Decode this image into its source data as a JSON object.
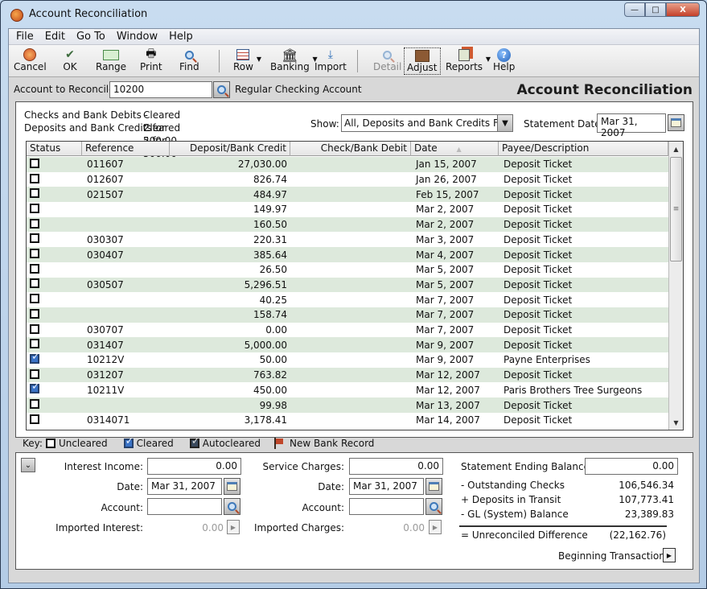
{
  "window": {
    "title": "Account Reconciliation",
    "controls": {
      "minimize": "—",
      "maximize": "□",
      "close": "X"
    }
  },
  "menubar": [
    "File",
    "Edit",
    "Go To",
    "Window",
    "Help"
  ],
  "toolbar": {
    "cancel": "Cancel",
    "ok": "OK",
    "range": "Range",
    "print": "Print",
    "find": "Find",
    "row": "Row",
    "banking": "Banking",
    "import": "Import",
    "detail": "Detail",
    "adjust": "Adjust",
    "reports": "Reports",
    "help": "Help"
  },
  "account": {
    "label": "Account to Reconcile:",
    "value": "10200",
    "description": "Regular Checking Account",
    "heading": "Account Reconciliation"
  },
  "summary": {
    "checks_label": "Checks and Bank Debits -",
    "checks_value": "Cleared 2 for 500.00",
    "deposits_label": "Deposits and Bank Credits -",
    "deposits_value": "Cleared 2 for 500.00"
  },
  "filters": {
    "show_label": "Show:",
    "show_value": "All, Deposits and Bank Credits First",
    "statement_date_label": "Statement Date:",
    "statement_date": "Mar 31, 2007"
  },
  "grid": {
    "columns": [
      "Status",
      "Reference",
      "Deposit/Bank Credit",
      "Check/Bank Debit",
      "Date",
      "Payee/Description"
    ],
    "sort_indicator": "▲",
    "rows": [
      {
        "status": false,
        "ref": "011607",
        "credit": "27,030.00",
        "debit": "",
        "date": "Jan 15, 2007",
        "payee": "Deposit Ticket"
      },
      {
        "status": false,
        "ref": "012607",
        "credit": "826.74",
        "debit": "",
        "date": "Jan 26, 2007",
        "payee": "Deposit Ticket"
      },
      {
        "status": false,
        "ref": "021507",
        "credit": "484.97",
        "debit": "",
        "date": "Feb 15, 2007",
        "payee": "Deposit Ticket"
      },
      {
        "status": false,
        "ref": "",
        "credit": "149.97",
        "debit": "",
        "date": "Mar 2, 2007",
        "payee": "Deposit Ticket"
      },
      {
        "status": false,
        "ref": "",
        "credit": "160.50",
        "debit": "",
        "date": "Mar 2, 2007",
        "payee": "Deposit Ticket"
      },
      {
        "status": false,
        "ref": "030307",
        "credit": "220.31",
        "debit": "",
        "date": "Mar 3, 2007",
        "payee": "Deposit Ticket"
      },
      {
        "status": false,
        "ref": "030407",
        "credit": "385.64",
        "debit": "",
        "date": "Mar 4, 2007",
        "payee": "Deposit Ticket"
      },
      {
        "status": false,
        "ref": "",
        "credit": "26.50",
        "debit": "",
        "date": "Mar 5, 2007",
        "payee": "Deposit Ticket"
      },
      {
        "status": false,
        "ref": "030507",
        "credit": "5,296.51",
        "debit": "",
        "date": "Mar 5, 2007",
        "payee": "Deposit Ticket"
      },
      {
        "status": false,
        "ref": "",
        "credit": "40.25",
        "debit": "",
        "date": "Mar 7, 2007",
        "payee": "Deposit Ticket"
      },
      {
        "status": false,
        "ref": "",
        "credit": "158.74",
        "debit": "",
        "date": "Mar 7, 2007",
        "payee": "Deposit Ticket"
      },
      {
        "status": false,
        "ref": "030707",
        "credit": "0.00",
        "debit": "",
        "date": "Mar 7, 2007",
        "payee": "Deposit Ticket"
      },
      {
        "status": false,
        "ref": "031407",
        "credit": "5,000.00",
        "debit": "",
        "date": "Mar 9, 2007",
        "payee": "Deposit Ticket"
      },
      {
        "status": true,
        "ref": "10212V",
        "credit": "50.00",
        "debit": "",
        "date": "Mar 9, 2007",
        "payee": "Payne Enterprises"
      },
      {
        "status": false,
        "ref": "031207",
        "credit": "763.82",
        "debit": "",
        "date": "Mar 12, 2007",
        "payee": "Deposit Ticket"
      },
      {
        "status": true,
        "ref": "10211V",
        "credit": "450.00",
        "debit": "",
        "date": "Mar 12, 2007",
        "payee": "Paris Brothers Tree Surgeons"
      },
      {
        "status": false,
        "ref": "",
        "credit": "99.98",
        "debit": "",
        "date": "Mar 13, 2007",
        "payee": "Deposit Ticket"
      },
      {
        "status": false,
        "ref": "0314071",
        "credit": "3,178.41",
        "debit": "",
        "date": "Mar 14, 2007",
        "payee": "Deposit Ticket"
      }
    ]
  },
  "key": {
    "label": "Key:",
    "uncleared": "Uncleared",
    "cleared": "Cleared",
    "autocleared": "Autocleared",
    "new_bank_record": "New Bank Record"
  },
  "interest": {
    "income_label": "Interest Income:",
    "income_value": "0.00",
    "date_label": "Date:",
    "date_value": "Mar 31, 2007",
    "account_label": "Account:",
    "account_value": "",
    "imported_label": "Imported Interest:",
    "imported_value": "0.00"
  },
  "charges": {
    "service_label": "Service Charges:",
    "service_value": "0.00",
    "date_label": "Date:",
    "date_value": "Mar 31, 2007",
    "account_label": "Account:",
    "account_value": "",
    "imported_label": "Imported Charges:",
    "imported_value": "0.00"
  },
  "balance": {
    "ending_label": "Statement Ending Balance:",
    "ending_value": "0.00",
    "outstanding_label": "- Outstanding Checks",
    "outstanding_value": "106,546.34",
    "transit_label": "+ Deposits in Transit",
    "transit_value": "107,773.41",
    "gl_label": "- GL (System) Balance",
    "gl_value": "23,389.83",
    "diff_label": "= Unreconciled Difference",
    "diff_value": "(22,162.76)",
    "beginning_label": "Beginning Transactions:"
  }
}
